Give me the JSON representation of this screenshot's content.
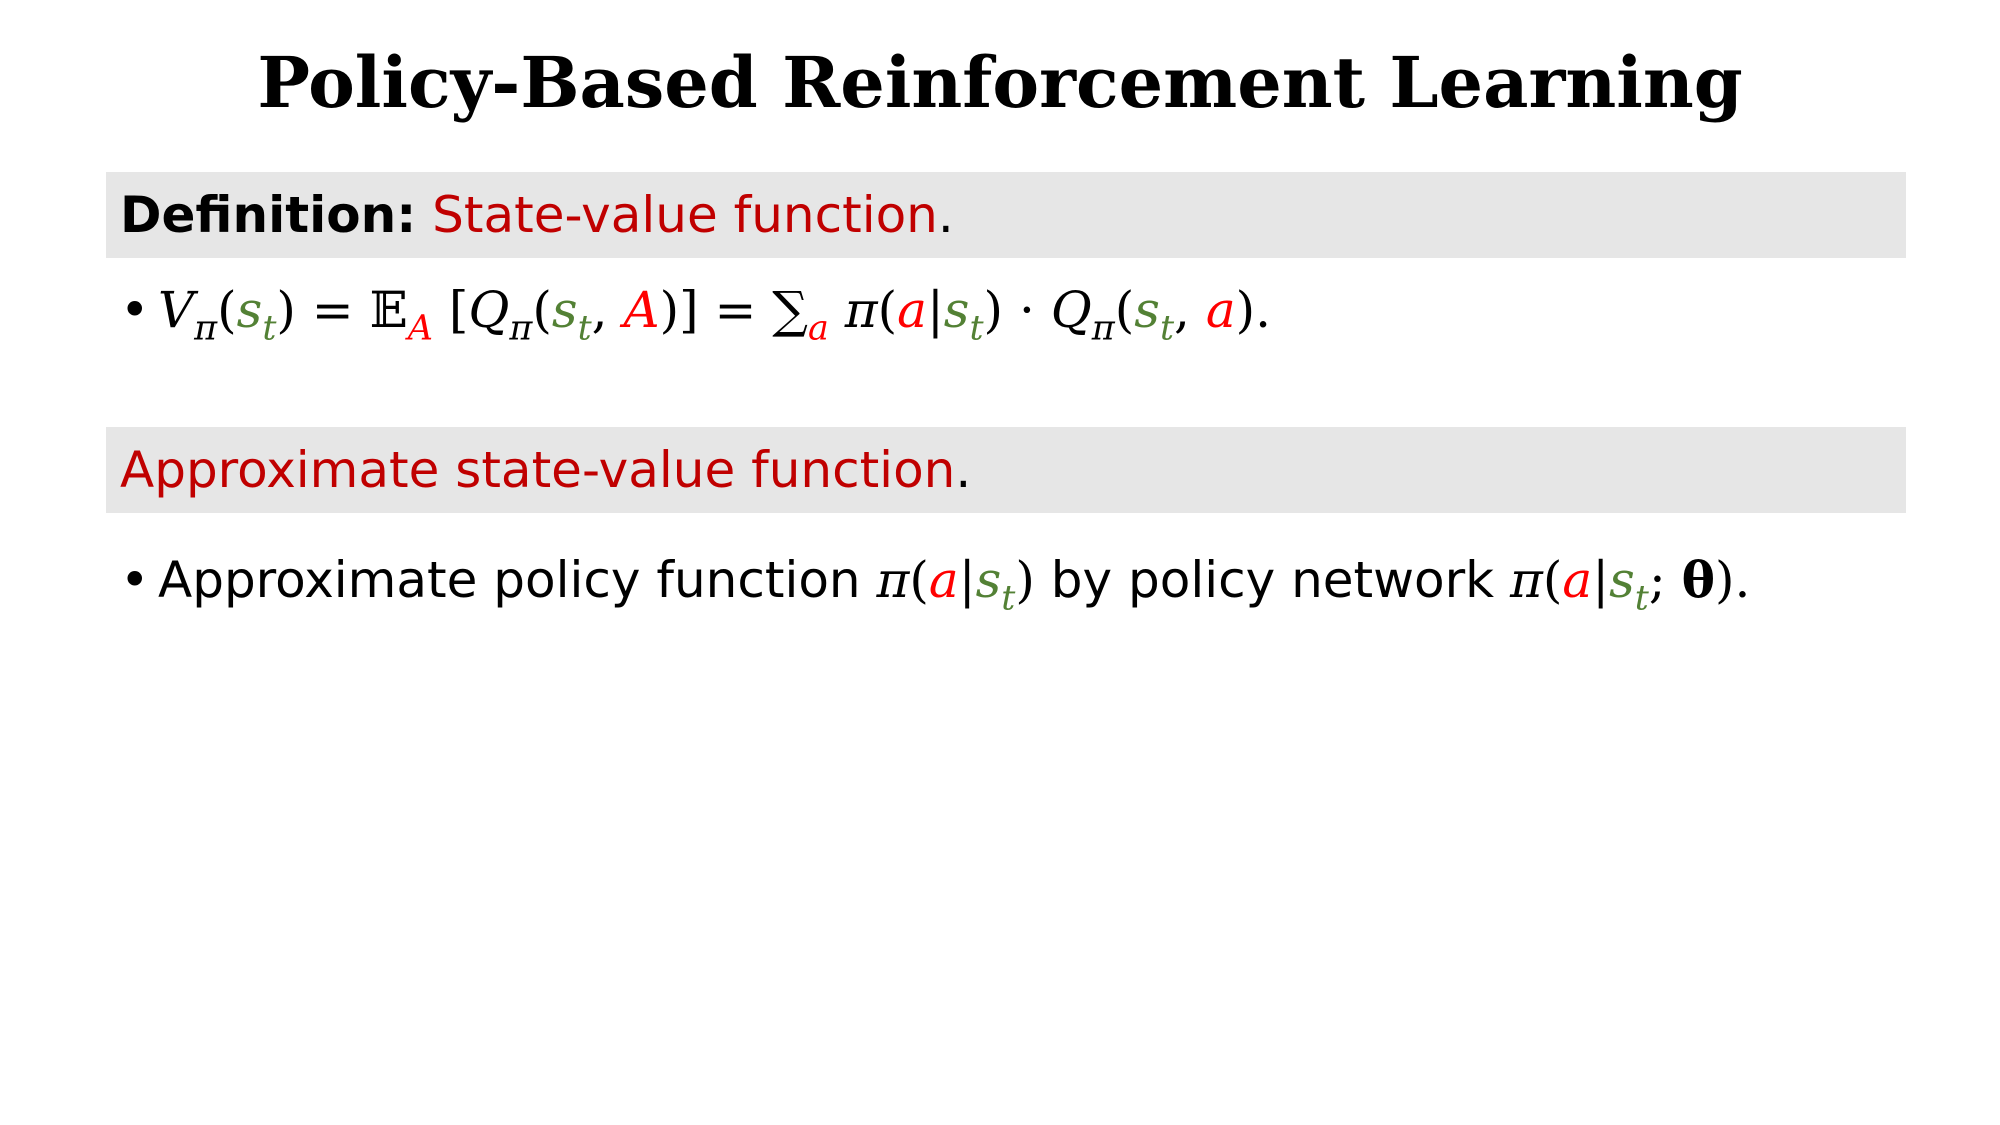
{
  "title": "Policy-Based Reinforcement Learning",
  "definition_band": {
    "label": "Definition:",
    "term": "State-value function",
    "period": "."
  },
  "approx_band": {
    "term": "Approximate state-value function",
    "period": "."
  },
  "bullets": {
    "symbol": "•",
    "b2_text1": "Approximate policy function",
    "b2_text2": "by policy network"
  },
  "colors": {
    "heading_red": "#c00000",
    "action_red": "#ff0000",
    "state_green": "#538135",
    "band_gray": "#e6e6e6"
  }
}
